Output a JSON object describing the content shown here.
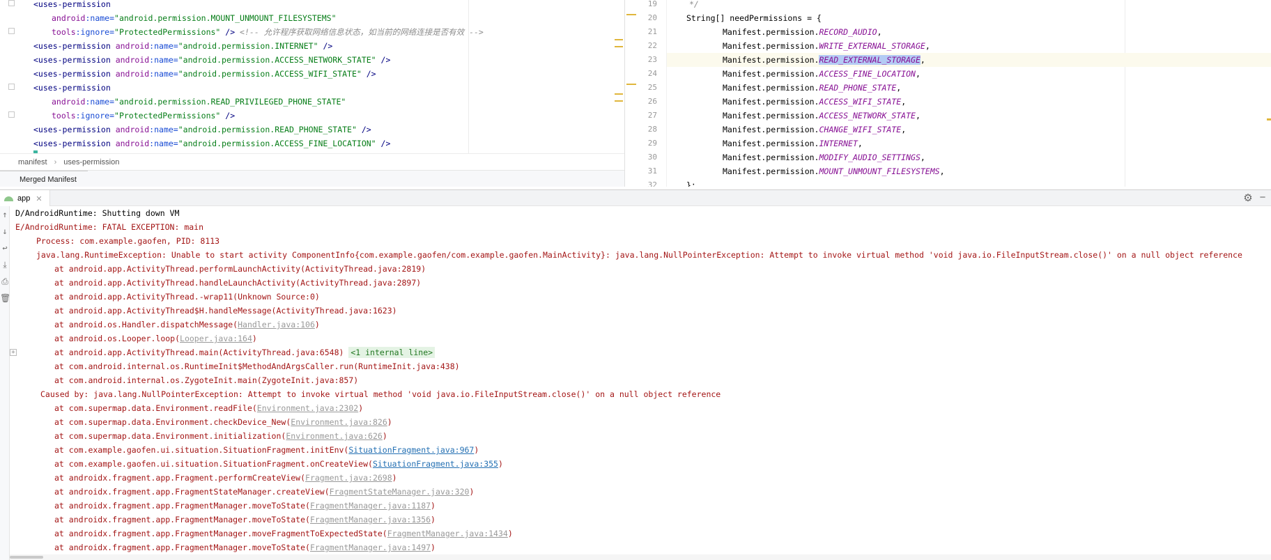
{
  "xml_editor": {
    "lines": [
      {
        "tokens": [
          {
            "t": "<uses-permission",
            "c": "tag"
          }
        ]
      },
      {
        "indent": 1,
        "tokens": [
          {
            "t": "android",
            "c": "ns"
          },
          {
            "t": ":name=",
            "c": "attr"
          },
          {
            "t": "\"android.permission.MOUNT_UNMOUNT_FILESYSTEMS\"",
            "c": "val"
          }
        ]
      },
      {
        "indent": 1,
        "tokens": [
          {
            "t": "tools",
            "c": "ns"
          },
          {
            "t": ":ignore=",
            "c": "attr"
          },
          {
            "t": "\"ProtectedPermissions\"",
            "c": "val"
          },
          {
            "t": " /> ",
            "c": "tag"
          },
          {
            "t": "<!-- 允许程序获取网络信息状态，如当前的网络连接是否有效 -->",
            "c": "cm"
          }
        ]
      },
      {
        "tokens": [
          {
            "t": "<uses-permission ",
            "c": "tag"
          },
          {
            "t": "android",
            "c": "ns"
          },
          {
            "t": ":name=",
            "c": "attr"
          },
          {
            "t": "\"android.permission.INTERNET\"",
            "c": "val"
          },
          {
            "t": " />",
            "c": "tag"
          }
        ]
      },
      {
        "tokens": [
          {
            "t": "<uses-permission ",
            "c": "tag"
          },
          {
            "t": "android",
            "c": "ns"
          },
          {
            "t": ":name=",
            "c": "attr"
          },
          {
            "t": "\"android.permission.ACCESS_NETWORK_STATE\"",
            "c": "val"
          },
          {
            "t": " />",
            "c": "tag"
          }
        ]
      },
      {
        "tokens": [
          {
            "t": "<uses-permission ",
            "c": "tag"
          },
          {
            "t": "android",
            "c": "ns"
          },
          {
            "t": ":name=",
            "c": "attr"
          },
          {
            "t": "\"android.permission.ACCESS_WIFI_STATE\"",
            "c": "val"
          },
          {
            "t": " />",
            "c": "tag"
          }
        ]
      },
      {
        "tokens": [
          {
            "t": "<uses-permission",
            "c": "tag"
          }
        ]
      },
      {
        "indent": 1,
        "tokens": [
          {
            "t": "android",
            "c": "ns"
          },
          {
            "t": ":name=",
            "c": "attr"
          },
          {
            "t": "\"android.permission.READ_PRIVILEGED_PHONE_STATE\"",
            "c": "val"
          }
        ]
      },
      {
        "indent": 1,
        "tokens": [
          {
            "t": "tools",
            "c": "ns"
          },
          {
            "t": ":ignore=",
            "c": "attr"
          },
          {
            "t": "\"ProtectedPermissions\"",
            "c": "val"
          },
          {
            "t": " />",
            "c": "tag"
          }
        ]
      },
      {
        "tokens": [
          {
            "t": "<uses-permission ",
            "c": "tag"
          },
          {
            "t": "android",
            "c": "ns"
          },
          {
            "t": ":name=",
            "c": "attr"
          },
          {
            "t": "\"android.permission.READ_PHONE_STATE\"",
            "c": "val"
          },
          {
            "t": " />",
            "c": "tag"
          }
        ]
      },
      {
        "tokens": [
          {
            "t": "<uses-permission ",
            "c": "tag"
          },
          {
            "t": "android",
            "c": "ns"
          },
          {
            "t": ":name=",
            "c": "attr"
          },
          {
            "t": "\"android.permission.ACCESS_FINE_LOCATION\"",
            "c": "val"
          },
          {
            "t": " />",
            "c": "tag"
          }
        ]
      }
    ],
    "breadcrumb": [
      "manifest",
      "uses-permission"
    ],
    "bottom_tab": "Merged Manifest"
  },
  "java_editor": {
    "current_line": 23,
    "lines": [
      {
        "num": "19",
        "text": "*/",
        "kind": "comment"
      },
      {
        "num": "20",
        "text": "String[] needPermissions = {",
        "kind": "decl"
      },
      {
        "num": "21",
        "prefix": "Manifest.permission.",
        "field": "RECORD_AUDIO",
        "suffix": ","
      },
      {
        "num": "22",
        "prefix": "Manifest.permission.",
        "field": "WRITE_EXTERNAL_STORAGE",
        "suffix": ","
      },
      {
        "num": "23",
        "prefix": "Manifest.permission.",
        "field": "READ_EXTERNAL_STORAGE",
        "suffix": ",",
        "highlight": true
      },
      {
        "num": "24",
        "prefix": "Manifest.permission.",
        "field": "ACCESS_FINE_LOCATION",
        "suffix": ","
      },
      {
        "num": "25",
        "prefix": "Manifest.permission.",
        "field": "READ_PHONE_STATE",
        "suffix": ","
      },
      {
        "num": "26",
        "prefix": "Manifest.permission.",
        "field": "ACCESS_WIFI_STATE",
        "suffix": ","
      },
      {
        "num": "27",
        "prefix": "Manifest.permission.",
        "field": "ACCESS_NETWORK_STATE",
        "suffix": ","
      },
      {
        "num": "28",
        "prefix": "Manifest.permission.",
        "field": "CHANGE_WIFI_STATE",
        "suffix": ","
      },
      {
        "num": "29",
        "prefix": "Manifest.permission.",
        "field": "INTERNET",
        "suffix": ","
      },
      {
        "num": "30",
        "prefix": "Manifest.permission.",
        "field": "MODIFY_AUDIO_SETTINGS",
        "suffix": ","
      },
      {
        "num": "31",
        "prefix": "Manifest.permission.",
        "field": "MOUNT_UNMOUNT_FILESYSTEMS",
        "suffix": ","
      },
      {
        "num": "32",
        "text": "};",
        "kind": "decl"
      }
    ]
  },
  "run_window": {
    "tab_label": "app",
    "icons": {
      "gear": "gear-icon",
      "minimize": "minimize-icon",
      "close": "close-icon"
    },
    "toolbar": [
      "up-arrow-icon",
      "down-arrow-icon",
      "soft-wrap-icon",
      "scroll-to-end-icon",
      "print-icon",
      "trash-icon"
    ]
  },
  "console": {
    "lines": [
      {
        "indent": 0,
        "plain": true,
        "parts": [
          {
            "t": "D/AndroidRuntime: Shutting down VM"
          }
        ]
      },
      {
        "indent": 0,
        "parts": [
          {
            "t": "E/AndroidRuntime: FATAL EXCEPTION: main"
          }
        ]
      },
      {
        "indent": 1,
        "parts": [
          {
            "t": "Process: com.example.gaofen, PID: 8113"
          }
        ]
      },
      {
        "indent": 1,
        "parts": [
          {
            "t": "java.lang.RuntimeException: Unable to start activity ComponentInfo{com.example.gaofen/com.example.gaofen.MainActivity}: java.lang.NullPointerException: Attempt to invoke virtual method 'void java.io.FileInputStream.close()' on a null object reference"
          }
        ]
      },
      {
        "indent": 2,
        "parts": [
          {
            "t": "at android.app.ActivityThread.performLaunchActivity(ActivityThread.java:2819)"
          }
        ]
      },
      {
        "indent": 2,
        "parts": [
          {
            "t": "at android.app.ActivityThread.handleLaunchActivity(ActivityThread.java:2897)"
          }
        ]
      },
      {
        "indent": 2,
        "parts": [
          {
            "t": "at android.app.ActivityThread.-wrap11(Unknown Source:0)"
          }
        ]
      },
      {
        "indent": 2,
        "parts": [
          {
            "t": "at android.app.ActivityThread$H.handleMessage(ActivityThread.java:1623)"
          }
        ]
      },
      {
        "indent": 2,
        "parts": [
          {
            "t": "at android.os.Handler.dispatchMessage("
          },
          {
            "t": "Handler.java:106",
            "link": "gray"
          },
          {
            "t": ")"
          }
        ]
      },
      {
        "indent": 2,
        "parts": [
          {
            "t": "at android.os.Looper.loop("
          },
          {
            "t": "Looper.java:164",
            "link": "gray"
          },
          {
            "t": ")"
          }
        ]
      },
      {
        "indent": 2,
        "expand": true,
        "parts": [
          {
            "t": "at android.app.ActivityThread.main(ActivityThread.java:6548) "
          },
          {
            "t": "<1 internal line>",
            "link": "internal"
          }
        ]
      },
      {
        "indent": 2,
        "parts": [
          {
            "t": "at com.android.internal.os.RuntimeInit$MethodAndArgsCaller.run(RuntimeInit.java:438)"
          }
        ]
      },
      {
        "indent": 2,
        "parts": [
          {
            "t": "at com.android.internal.os.ZygoteInit.main(ZygoteInit.java:857)"
          }
        ]
      },
      {
        "indent": 1,
        "extra": true,
        "parts": [
          {
            "t": "Caused by: java.lang.NullPointerException: Attempt to invoke virtual method 'void java.io.FileInputStream.close()' on a null object reference"
          }
        ]
      },
      {
        "indent": 2,
        "parts": [
          {
            "t": "at com.supermap.data.Environment.readFile("
          },
          {
            "t": "Environment.java:2302",
            "link": "gray"
          },
          {
            "t": ")"
          }
        ]
      },
      {
        "indent": 2,
        "parts": [
          {
            "t": "at com.supermap.data.Environment.checkDevice_New("
          },
          {
            "t": "Environment.java:826",
            "link": "gray"
          },
          {
            "t": ")"
          }
        ]
      },
      {
        "indent": 2,
        "parts": [
          {
            "t": "at com.supermap.data.Environment.initialization("
          },
          {
            "t": "Environment.java:626",
            "link": "gray"
          },
          {
            "t": ")"
          }
        ]
      },
      {
        "indent": 2,
        "parts": [
          {
            "t": "at com.example.gaofen.ui.situation.SituationFragment.initEnv("
          },
          {
            "t": "SituationFragment.java:967",
            "link": "blue"
          },
          {
            "t": ")"
          }
        ]
      },
      {
        "indent": 2,
        "parts": [
          {
            "t": "at com.example.gaofen.ui.situation.SituationFragment.onCreateView("
          },
          {
            "t": "SituationFragment.java:355",
            "link": "blue"
          },
          {
            "t": ")"
          }
        ]
      },
      {
        "indent": 2,
        "parts": [
          {
            "t": "at androidx.fragment.app.Fragment.performCreateView("
          },
          {
            "t": "Fragment.java:2698",
            "link": "gray"
          },
          {
            "t": ")"
          }
        ]
      },
      {
        "indent": 2,
        "parts": [
          {
            "t": "at androidx.fragment.app.FragmentStateManager.createView("
          },
          {
            "t": "FragmentStateManager.java:320",
            "link": "gray"
          },
          {
            "t": ")"
          }
        ]
      },
      {
        "indent": 2,
        "parts": [
          {
            "t": "at androidx.fragment.app.FragmentManager.moveToState("
          },
          {
            "t": "FragmentManager.java:1187",
            "link": "gray"
          },
          {
            "t": ")"
          }
        ]
      },
      {
        "indent": 2,
        "parts": [
          {
            "t": "at androidx.fragment.app.FragmentManager.moveToState("
          },
          {
            "t": "FragmentManager.java:1356",
            "link": "gray"
          },
          {
            "t": ")"
          }
        ]
      },
      {
        "indent": 2,
        "parts": [
          {
            "t": "at androidx.fragment.app.FragmentManager.moveFragmentToExpectedState("
          },
          {
            "t": "FragmentManager.java:1434",
            "link": "gray"
          },
          {
            "t": ")"
          }
        ]
      },
      {
        "indent": 2,
        "parts": [
          {
            "t": "at androidx.fragment.app.FragmentManager.moveToState("
          },
          {
            "t": "FragmentManager.java:1497",
            "link": "gray"
          },
          {
            "t": ")"
          }
        ]
      }
    ]
  }
}
